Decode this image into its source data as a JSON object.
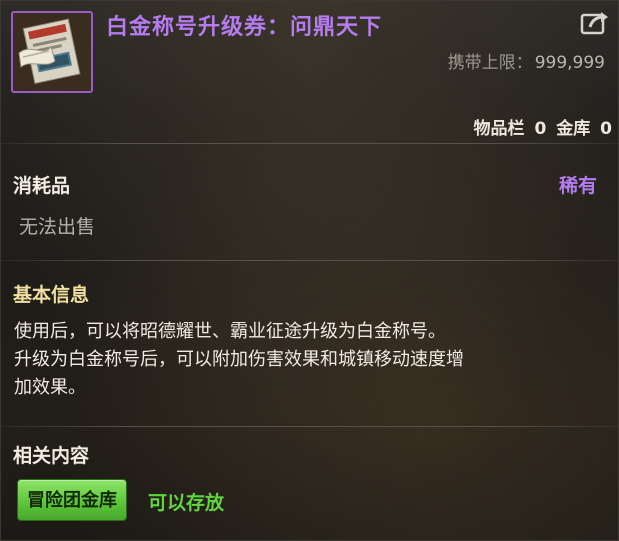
{
  "item": {
    "name": "白金称号升级券：问鼎天下",
    "icon": "title-upgrade-ticket-icon",
    "name_color": "#b57cf0"
  },
  "header": {
    "carry_limit_label": "携带上限：",
    "carry_limit_value": "999,999",
    "share_icon": "share-export-icon",
    "storage": {
      "inventory_label": "物品栏",
      "inventory_count": "0",
      "bank_label": "金库",
      "bank_count": "0"
    }
  },
  "type": {
    "label": "消耗品",
    "rarity": "稀有",
    "rarity_color": "#b57cf0",
    "sell_status": "无法出售"
  },
  "basic_info": {
    "title": "基本信息",
    "lines": [
      "使用后，可以将昭德耀世、霸业征途升级为白金称号。",
      "升级为白金称号后，可以附加伤害效果和城镇移动速度增",
      "加效果。"
    ]
  },
  "related": {
    "title": "相关内容",
    "tag_label": "冒险团金库",
    "tag_color": "#5ec63b",
    "status": "可以存放"
  }
}
